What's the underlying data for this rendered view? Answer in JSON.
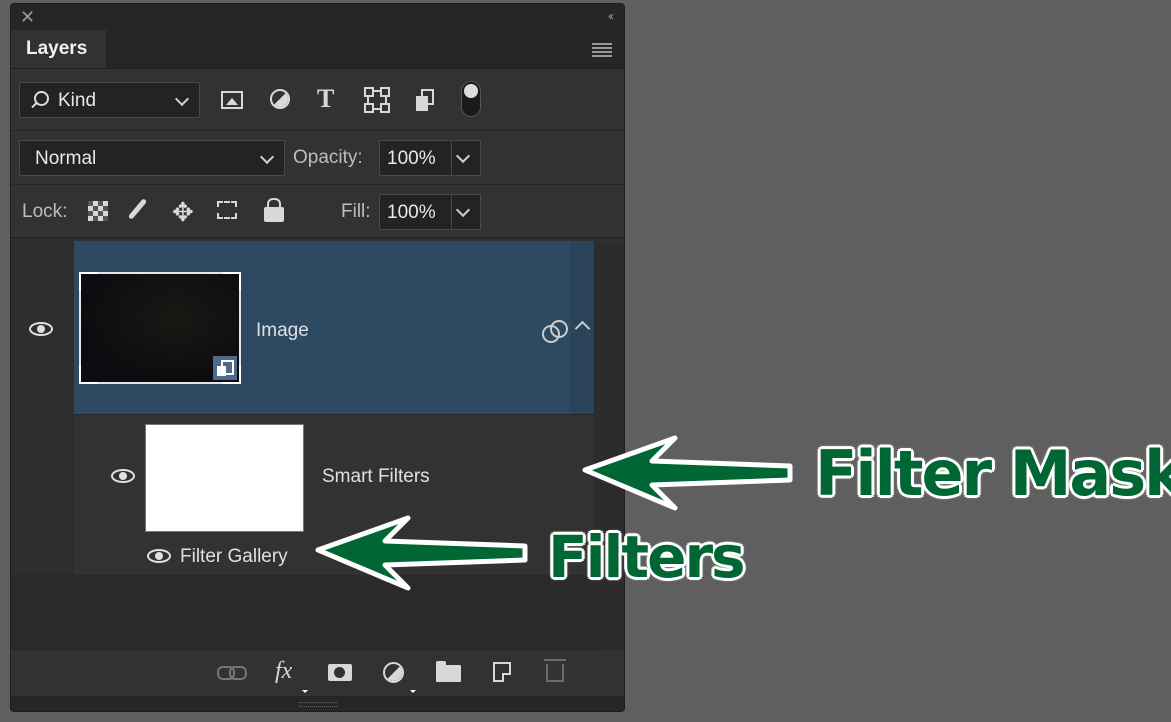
{
  "panel": {
    "close_glyph": "✕",
    "collapse_glyph": "‹‹",
    "tab": "Layers"
  },
  "filter_row": {
    "kind_label": "Kind",
    "icons": [
      "pixel-layer-filter-icon",
      "adjustment-layer-filter-icon",
      "type-layer-filter-icon",
      "shape-layer-filter-icon",
      "smart-object-filter-icon"
    ],
    "type_glyph": "T",
    "toggle_on": true
  },
  "blend_row": {
    "blend_mode": "Normal",
    "opacity_label": "Opacity:",
    "opacity_value": "100%"
  },
  "lock_row": {
    "lock_label": "Lock:",
    "move_glyph": "✥",
    "fill_label": "Fill:",
    "fill_value": "100%"
  },
  "layers": [
    {
      "name": "Image",
      "visible": true,
      "selected": true,
      "smart_object": true,
      "smart_filters": {
        "label": "Smart Filters",
        "mask": "white",
        "filters": [
          {
            "name": "Filter Gallery",
            "visible": true
          }
        ]
      }
    }
  ],
  "bottom_bar": {
    "icons": [
      "link-layers-icon",
      "layer-style-icon",
      "add-mask-icon",
      "adjustment-layer-icon",
      "new-group-icon",
      "new-layer-icon",
      "delete-layer-icon"
    ],
    "fx_label": "fx"
  },
  "annotations": {
    "filter_mask": "Filter Mask",
    "filters": "Filters",
    "color": "#006633"
  }
}
